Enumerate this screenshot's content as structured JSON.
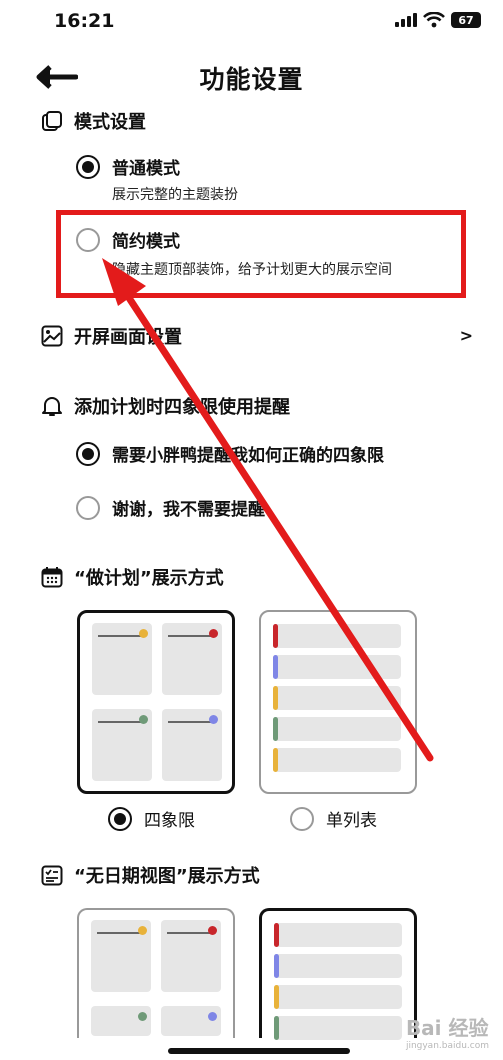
{
  "status_bar": {
    "time": "16:21",
    "battery": "67"
  },
  "header": {
    "title": "功能设置"
  },
  "mode_section": {
    "title": "模式设置",
    "options": [
      {
        "label": "普通模式",
        "desc": "展示完整的主题装扮",
        "selected": true
      },
      {
        "label": "简约模式",
        "desc": "隐藏主题顶部装饰，给予计划更大的展示空间",
        "selected": false
      }
    ]
  },
  "splash_section": {
    "title": "开屏画面设置",
    "chevron": ">"
  },
  "reminder_section": {
    "title": "添加计划时四象限使用提醒",
    "options": [
      {
        "label": "需要小胖鸭提醒我如何正确的四象限",
        "selected": true
      },
      {
        "label": "谢谢，我不需要提醒",
        "selected": false
      }
    ]
  },
  "plan_display_section": {
    "title": "“做计划”展示方式",
    "options": [
      {
        "label": "四象限",
        "selected": true
      },
      {
        "label": "单列表",
        "selected": false
      }
    ]
  },
  "undated_display_section": {
    "title": "“无日期视图”展示方式"
  },
  "colors": {
    "highlight": "#e31b1b",
    "quad_dots": [
      "#e8b23a",
      "#c8262b",
      "#6f9a78",
      "#7f86e6"
    ],
    "list_bars": [
      "#c8262b",
      "#7f86e6",
      "#e8b23a",
      "#6f9a78",
      "#e8b23a"
    ]
  },
  "watermark": {
    "text": "Bai 经验",
    "sub": "jingyan.baidu.com"
  }
}
